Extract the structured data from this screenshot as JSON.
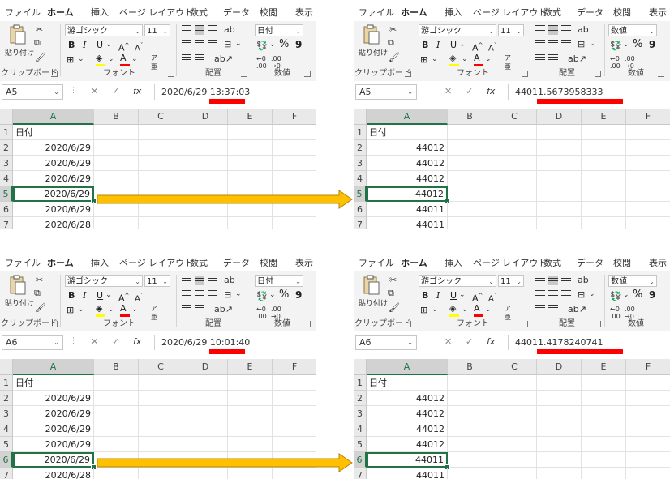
{
  "ribbon_tabs": [
    "ファイル",
    "ホーム",
    "挿入",
    "ページ レイアウト",
    "数式",
    "データ",
    "校閲",
    "表示"
  ],
  "clipboard": {
    "paste_label": "貼り付け",
    "group_label": "クリップボード"
  },
  "font": {
    "name_left": "游ゴシック",
    "name_right": "游ゴシック",
    "size": "11",
    "group_label": "フォント",
    "underline_color": "#ff0000",
    "highlight_color": "#ffff00"
  },
  "alignment": {
    "group_label": "配置"
  },
  "number": {
    "group_label": "数値",
    "format_left": "日付",
    "format_right": "数値",
    "percent": "%",
    "comma": "9"
  },
  "formula_controls": {
    "cancel": "✕",
    "enter": "✓",
    "fx": "fx"
  },
  "col_headers": [
    "A",
    "B",
    "C",
    "D",
    "E",
    "F"
  ],
  "panels": {
    "top_left": {
      "namebox": "A5",
      "formula": "2020/6/29 13:37:03",
      "rows": [
        "1",
        "2",
        "3",
        "4",
        "5",
        "6",
        "7"
      ],
      "header": "日付",
      "values": [
        "2020/6/29",
        "2020/6/29",
        "2020/6/29",
        "2020/6/29",
        "2020/6/29",
        "2020/6/28"
      ],
      "active_row": "5"
    },
    "top_right": {
      "namebox": "A5",
      "formula": "44011.5673958333",
      "rows": [
        "1",
        "2",
        "3",
        "4",
        "5",
        "6",
        "7"
      ],
      "header": "日付",
      "values": [
        "44012",
        "44012",
        "44012",
        "44012",
        "44011",
        "44011"
      ],
      "active_row": "5"
    },
    "bottom_left": {
      "namebox": "A6",
      "formula": "2020/6/29 10:01:40",
      "rows": [
        "1",
        "2",
        "3",
        "4",
        "5",
        "6",
        "7"
      ],
      "header": "日付",
      "values": [
        "2020/6/29",
        "2020/6/29",
        "2020/6/29",
        "2020/6/29",
        "2020/6/29",
        "2020/6/28"
      ],
      "active_row": "6"
    },
    "bottom_right": {
      "namebox": "A6",
      "formula": "44011.4178240741",
      "rows": [
        "1",
        "2",
        "3",
        "4",
        "5",
        "6",
        "7"
      ],
      "header": "日付",
      "values": [
        "44012",
        "44012",
        "44012",
        "44012",
        "44011",
        "44011"
      ],
      "active_row": "6"
    }
  },
  "colors": {
    "accent": "#217346",
    "arrow_fill": "#ffc000",
    "arrow_stroke": "#b8860b",
    "mark": "#ff0000"
  }
}
